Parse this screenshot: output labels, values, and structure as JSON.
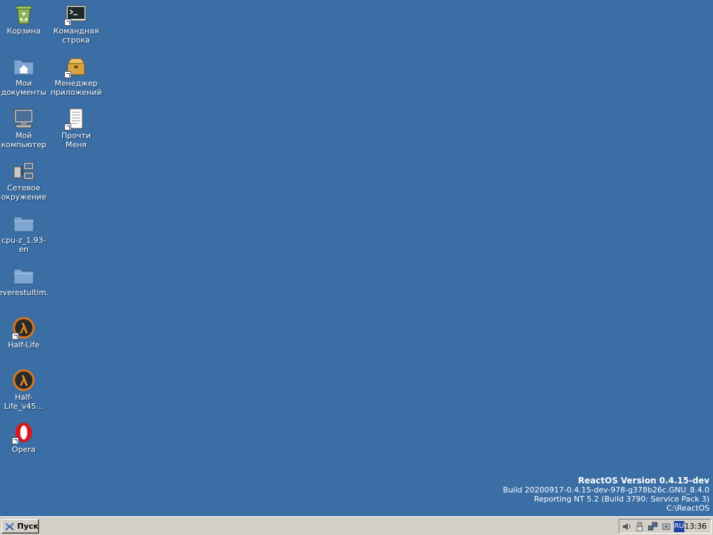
{
  "desktop": {
    "background_color": "#3a6ea5",
    "icons": [
      {
        "label": "Корзина",
        "icon": "recycle-bin-icon"
      },
      {
        "label": "Командная\nстрока",
        "icon": "command-prompt-icon"
      },
      {
        "label": "Мои\nдокументы",
        "icon": "my-documents-icon"
      },
      {
        "label": "Менеджер\nприложений",
        "icon": "app-manager-icon"
      },
      {
        "label": "Мой\nкомпьютер",
        "icon": "my-computer-icon"
      },
      {
        "label": "Прочти\nМеня",
        "icon": "readme-icon"
      },
      {
        "label": "Сетевое\nокружение",
        "icon": "network-places-icon"
      },
      {
        "label": "cpu-z_1.93-en",
        "icon": "folder-icon"
      },
      {
        "label": "everestultim...",
        "icon": "folder-icon"
      },
      {
        "label": "Half-Life",
        "icon": "half-life-icon"
      },
      {
        "label": "Half-Life_v45...",
        "icon": "half-life-icon"
      },
      {
        "label": "Opera",
        "icon": "opera-icon"
      }
    ]
  },
  "version_info": {
    "title": "ReactOS Version 0.4.15-dev",
    "build": "Build 20200917-0.4.15-dev-978-g378b26c.GNU_8.4.0",
    "reporting": "Reporting NT 5.2 (Build 3790: Service Pack 3)",
    "path": "C:\\ReactOS"
  },
  "taskbar": {
    "start_label": "Пуск",
    "tray_icons": [
      "volume-icon",
      "usb-icon",
      "network-icon",
      "safely-remove-icon"
    ],
    "language": "RU",
    "clock": "13:36"
  }
}
